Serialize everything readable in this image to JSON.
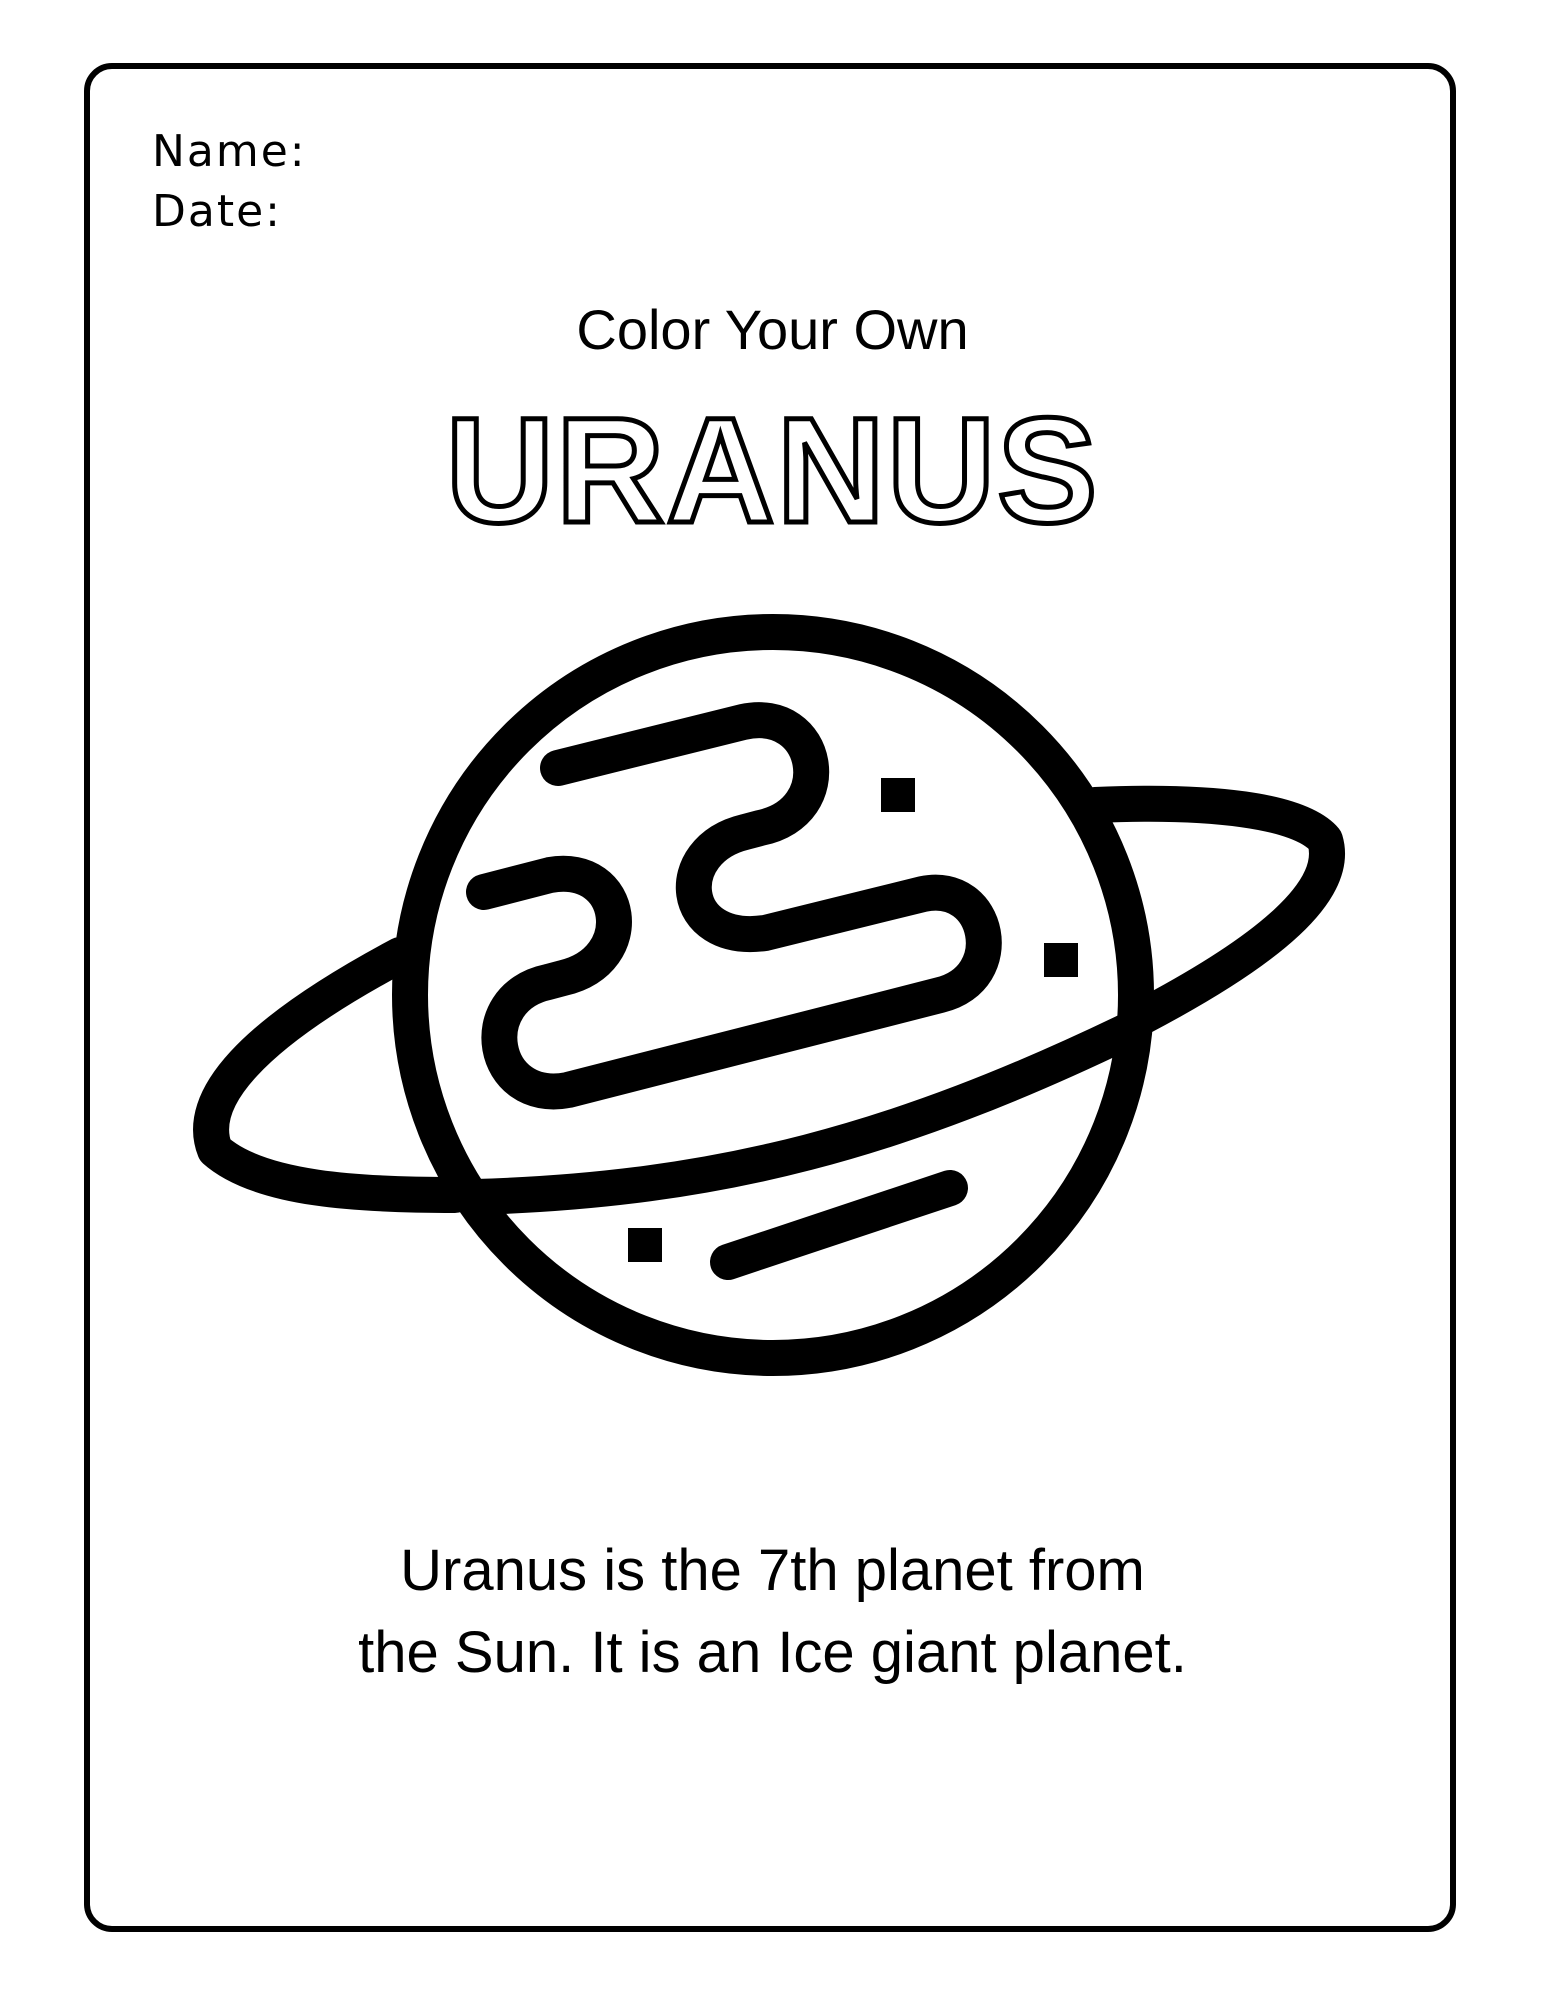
{
  "worksheet": {
    "name_label": "Name:",
    "date_label": "Date:",
    "subtitle": "Color Your Own",
    "title": "URANUS",
    "fact_line_1": "Uranus is the 7th planet from",
    "fact_line_2": "the Sun. It is an Ice giant planet."
  },
  "illustration": {
    "icon": "ringed-planet-outline-icon",
    "stroke_color": "#000000",
    "fill_color": "#ffffff"
  }
}
